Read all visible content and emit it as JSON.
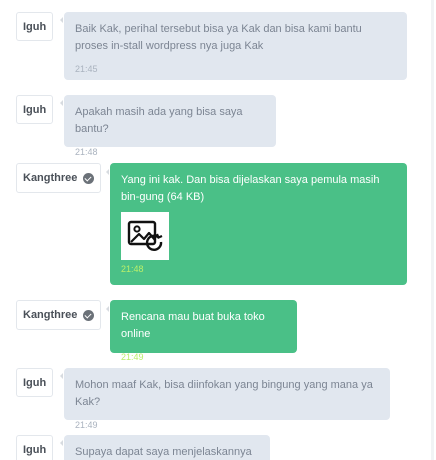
{
  "messages": [
    {
      "sender": "Iguh",
      "text": "Baik Kak, perihal tersebut bisa ya Kak dan bisa kami bantu proses in-stall wordpress nya juga Kak",
      "time": "21:45"
    },
    {
      "sender": "Iguh",
      "text": "Apakah masih ada yang bisa saya bantu?",
      "time": "21:48"
    },
    {
      "sender": "Kangthree",
      "text": "Yang ini kak. Dan bisa dijelaskan saya pemula masih bin-gung (64 KB)",
      "time": "21:48"
    },
    {
      "sender": "Kangthree",
      "text": "Rencana mau buat buka toko online",
      "time": "21:49"
    },
    {
      "sender": "Iguh",
      "text": "Mohon maaf Kak, bisa diinfokan yang bingung yang mana ya Kak?",
      "time": "21:49"
    },
    {
      "sender": "Iguh",
      "text": "Supaya dapat saya menjelaskannya Kak",
      "time": ""
    }
  ],
  "icons": {
    "verified": "verified-check-icon",
    "attachment": "image-refresh-icon"
  },
  "colors": {
    "agent_bubble": "#e1e7ef",
    "customer_bubble": "#4ac087",
    "customer_time": "#b9ef6a"
  }
}
